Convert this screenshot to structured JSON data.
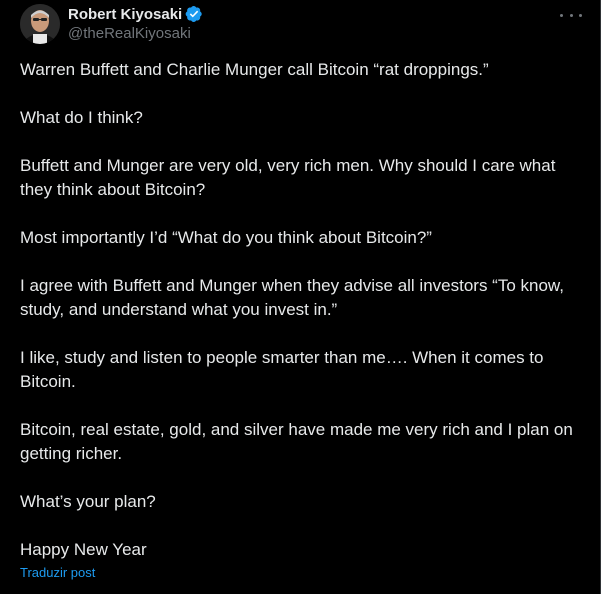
{
  "author": {
    "display_name": "Robert Kiyosaki",
    "handle": "@theRealKiyosaki",
    "verified": true,
    "verified_color": "#1d9bf0"
  },
  "more_menu_icon": "more-horizontal-icon",
  "tweet": {
    "paragraphs": [
      "Warren Buffett and Charlie Munger call Bitcoin “rat droppings.”",
      "What do I think?",
      "Buffett and Munger are very old, very rich men.  Why should I care what they think about Bitcoin?",
      "Most importantly I’d “What do you think about Bitcoin?”",
      "I agree with  Buffett and Munger when they advise all investors “To know, study, and understand what you invest in.”",
      "I like, study and listen to people smarter than me…. When it comes to Bitcoin.",
      "Bitcoin, real estate, gold, and silver have made me very rich and I plan on getting richer.",
      "What’s your plan?",
      "Happy New Year"
    ]
  },
  "translate_link": "Traduzir post",
  "colors": {
    "background": "#000000",
    "text": "#e7e9ea",
    "secondary": "#71767b",
    "accent": "#1d9bf0"
  }
}
